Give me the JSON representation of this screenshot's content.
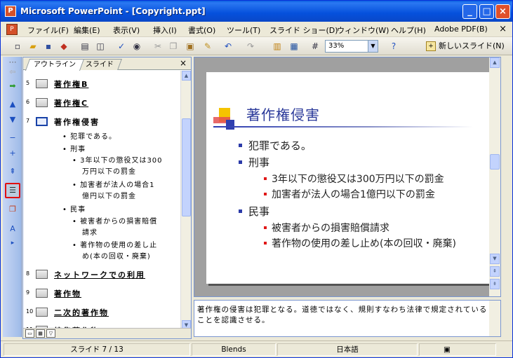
{
  "window": {
    "title": "Microsoft PowerPoint - [Copyright.ppt]",
    "minimize": "_",
    "maximize": "□",
    "close": "×"
  },
  "menu": {
    "items": [
      "ファイル(F)",
      "編集(E)",
      "表示(V)",
      "挿入(I)",
      "書式(O)",
      "ツール(T)",
      "スライド ショー(D)",
      "ウィンドウ(W)",
      "ヘルプ(H)",
      "Adobe PDF(B)"
    ],
    "close": "×"
  },
  "toolbar": {
    "zoom": "33%",
    "new_slide_label": "新しいスライド(N)",
    "zoom_dropdown": "▼"
  },
  "outline_pane": {
    "tab_outline": "アウトライン",
    "tab_slides": "スライド",
    "close": "×",
    "slides": [
      {
        "num": "5",
        "title": "著作権B"
      },
      {
        "num": "6",
        "title": "著作権C"
      },
      {
        "num": "7",
        "title": "著作権侵害"
      },
      {
        "num": "8",
        "title": "ネットワークでの利用"
      },
      {
        "num": "9",
        "title": "著作物"
      },
      {
        "num": "10",
        "title": "二次的著作物"
      },
      {
        "num": "11",
        "title": "編集著作物"
      }
    ],
    "lines": [
      "• 犯罪である。",
      "• 刑事",
      "• 3年以下の懲役又は300",
      "万円以下の罰金",
      "• 加害者が法人の場合1",
      "億円以下の罰金",
      "• 民事",
      "• 被害者からの損害賠償",
      "請求",
      "• 著作物の使用の差し止",
      "め(本の回収・廃棄)"
    ]
  },
  "slide": {
    "title": "著作権侵害",
    "bullets": [
      "犯罪である。",
      "刑事",
      "民事"
    ],
    "sub_criminal": [
      "3年以下の懲役又は300万円以下の罰金",
      "加害者が法人の場合1億円以下の罰金"
    ],
    "sub_civil": [
      "被害者からの損害賠償請求",
      "著作物の使用の差し止め(本の回収・廃棄)"
    ]
  },
  "notes": {
    "text": "著作権の侵害は犯罪となる。道徳ではなく、規則すなわち法律で規定されていることを認識させる。"
  },
  "status": {
    "slide": "スライド 7 / 13",
    "design": "Blends",
    "language": "日本語"
  },
  "colors": {
    "title_blue": "#2b3a9a",
    "bullet_blue": "#2b3aa8",
    "bullet_red": "#e01818",
    "highlight_red": "#e01010"
  }
}
